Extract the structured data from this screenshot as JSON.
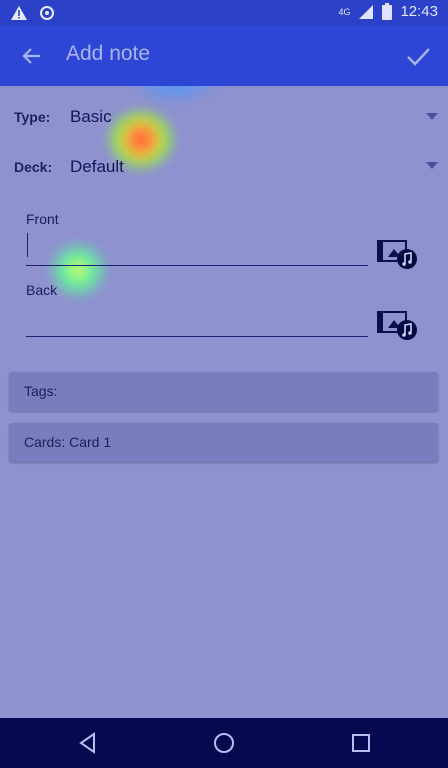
{
  "status_bar": {
    "time": "12:43",
    "network": "4G",
    "icons": [
      "warning-icon",
      "sync-icon",
      "signal-icon",
      "battery-icon"
    ]
  },
  "app_bar": {
    "title": "Add note",
    "back_icon": "arrow-back-icon",
    "confirm_icon": "check-icon"
  },
  "form": {
    "type": {
      "label": "Type:",
      "value": "Basic"
    },
    "deck": {
      "label": "Deck:",
      "value": "Default"
    },
    "fields": [
      {
        "label": "Front",
        "value": ""
      },
      {
        "label": "Back",
        "value": ""
      }
    ],
    "media_icon": "multimedia-icon"
  },
  "panels": {
    "tags": "Tags:",
    "cards": "Cards: Card 1"
  },
  "nav": {
    "buttons": [
      "back-triangle-icon",
      "home-circle-icon",
      "recents-square-icon"
    ]
  },
  "colors": {
    "status_bar": "#2b42c8",
    "app_bar": "#2d46d6",
    "background": "#8f92cf",
    "navbar": "#050a50"
  }
}
